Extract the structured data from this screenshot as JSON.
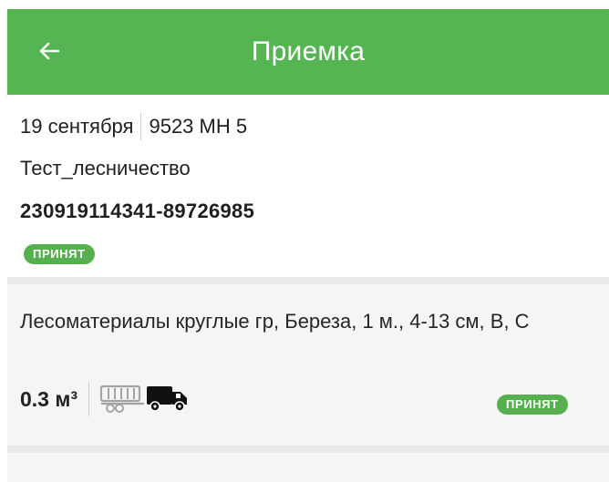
{
  "header": {
    "title": "Приемка",
    "back_icon": "arrow-left-icon",
    "color": "#56b553"
  },
  "document": {
    "date": "19 сентября",
    "vehicle_number": "9523 МН 5",
    "forestry": "Тест_лесничество",
    "number": "230919114341-89726985",
    "status": "ПРИНЯТ"
  },
  "items": [
    {
      "title": "Лесоматериалы круглые гр, Береза, 1 м., 4-13 см, В, С",
      "volume": "0.3 м³",
      "icons": [
        "trailer-icon",
        "truck-icon"
      ],
      "status": "ПРИНЯТ"
    }
  ],
  "colors": {
    "accent": "#56b553",
    "badge": "#57b04f",
    "divider": "#e9e9e9"
  }
}
